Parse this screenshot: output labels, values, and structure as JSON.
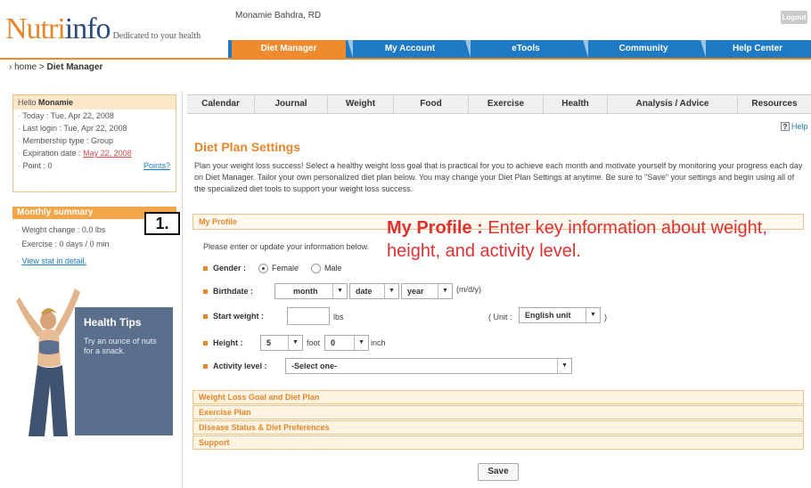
{
  "brand": {
    "logo_part1": "Nutri",
    "logo_part2": "info",
    "tagline": "Dedicated to your health"
  },
  "header": {
    "user_name": "Monamie Bahdra, RD",
    "logout": "Logout"
  },
  "main_nav": [
    "Diet Manager",
    "My Account",
    "eTools",
    "Community",
    "Help Center"
  ],
  "main_nav_active": "Diet Manager",
  "breadcrumb": {
    "home": "home",
    "sep": ">",
    "current": "Diet Manager"
  },
  "sidebar": {
    "hello_prefix": "Hello",
    "hello_name": "Monamie",
    "today": "Today : Tue, Apr 22, 2008",
    "last_login": "Last login : Tue, Apr 22, 2008",
    "membership": "Membership type : Group",
    "expiration_label": "Expiration date :",
    "expiration_value": "May 22, 2008",
    "point": "Point : 0",
    "points_link": "Points?",
    "monthly_title": "Monthly summary",
    "weight_change": "Weight change : 0.0 lbs",
    "exercise": "Exercise : 0 days / 0 min",
    "view_stat": "View stat in detail.",
    "tips_title": "Health Tips",
    "tips_text": "Try an ounce of nuts for a snack."
  },
  "step_label": "1.",
  "sub_nav": [
    "Calendar",
    "Journal",
    "Weight",
    "Food",
    "Exercise",
    "Health",
    "Analysis / Advice",
    "Resources"
  ],
  "help": "Help",
  "page_title": "Diet Plan Settings",
  "intro": "Plan your weight loss success! Select a healthy weight loss goal that is practical for you to achieve each month and motivate yourself by monitoring your progress each day on Diet Manager. Tailor your own personalized diet plan below. You may change your Diet Plan Settings at anytime. Be sure to \"Save\" your settings and begin using all of the specialized diet tools to support your weight loss success.",
  "my_profile": {
    "heading": "My Profile",
    "prompt": "Please enter or update your information below.",
    "gender_label": "Gender :",
    "gender_female": "Female",
    "gender_male": "Male",
    "birthdate_label": "Birthdate :",
    "month": "month",
    "date": "date",
    "year": "year",
    "date_format": "(m/d/y)",
    "start_weight_label": "Start weight :",
    "start_weight_value": "",
    "weight_unit": "lbs",
    "unit_label": "( Unit :",
    "unit_value": "English unit",
    "unit_close": ")",
    "height_label": "Height :",
    "height_foot": "5",
    "foot": "foot",
    "height_inch": "0",
    "inch": "inch",
    "activity_label": "Activity level :",
    "activity_value": "-Select one-"
  },
  "annotation": {
    "bold": "My Profile :",
    "text": "Enter key information about weight, height, and activity level."
  },
  "sections": [
    "Weight Loss Goal and Diet Plan",
    "Exercise Plan",
    "Disease Status & Diet Preferences",
    "Support"
  ],
  "save": "Save",
  "colors": {
    "orange": "#f08a2f",
    "blue": "#1e7ac4",
    "red_annotation": "#e03131",
    "panel": "#5a6f8c"
  }
}
